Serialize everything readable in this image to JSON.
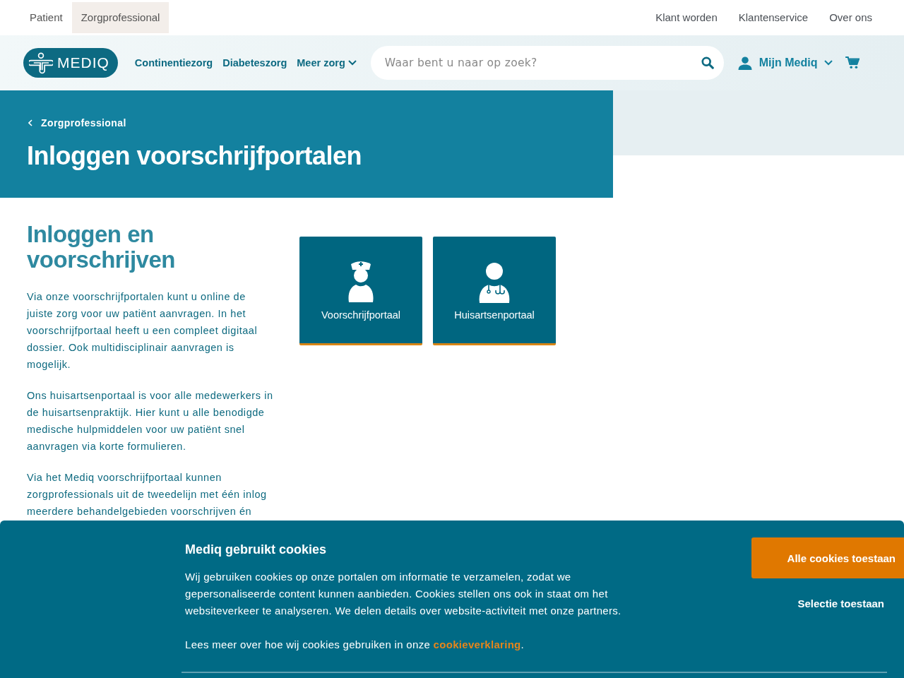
{
  "audience_tabs": [
    {
      "label": "Patient",
      "selected": false
    },
    {
      "label": "Zorgprofessional",
      "selected": true
    }
  ],
  "top_links": [
    "Klant worden",
    "Klantenservice",
    "Over ons"
  ],
  "header": {
    "logo": "MEDIQ",
    "nav": [
      {
        "label": "Continentiezorg",
        "kind": "link"
      },
      {
        "label": "Diabeteszorg",
        "kind": "link"
      },
      {
        "label": "Meer zorg",
        "kind": "dropdown"
      }
    ],
    "search": {
      "placeholder": "Waar bent u naar op zoek?"
    },
    "account": "Mijn Mediq"
  },
  "hero": {
    "breadcrumb": "Zorgprofessional",
    "title": "Inloggen voorschrijfportalen"
  },
  "content": {
    "heading": "Inloggen en voorschrijven",
    "paragraphs": [
      "Via onze voorschrijfportalen kunt u online de juiste zorg voor uw patiënt aanvragen. In het voorschrijfportaal heeft u een compleet digitaal dossier. Ook multidisciplinair aanvragen is mogelijk.",
      "Ons huisartsenportaal is voor alle medewerkers in de huisartsenpraktijk. Hier kunt u alle benodigde medische hulpmiddelen voor uw patiënt snel aanvragen via korte formulieren.",
      "Via het Mediq voorschrijfportaal kunnen zorgprofessionals uit de tweedelijn met één inlog meerdere behandelgebieden voorschrijven én"
    ]
  },
  "portals": [
    {
      "label": "Voorschrijfportaal",
      "kind": "nurse"
    },
    {
      "label": "Huisartsenportaal",
      "kind": "doctor"
    }
  ],
  "cookie_banner": {
    "title": "Mediq gebruikt cookies",
    "text": "Wij gebruiken cookies op onze portalen om informatie te verzamelen, zodat we gepersonaliseerde content kunnen aanbieden. Cookies stellen ons ook in staat om het websiteverkeer te analyseren. We delen details over website-activiteit met onze partners.",
    "more_text": "Lees meer over hoe wij cookies gebruiken in onze",
    "link": "cookieverklaring",
    "link_end": ".",
    "buttons": [
      {
        "label": "Alle cookies toestaan",
        "kind": "primary"
      },
      {
        "label": "Selectie toestaan",
        "kind": "text"
      }
    ]
  }
}
